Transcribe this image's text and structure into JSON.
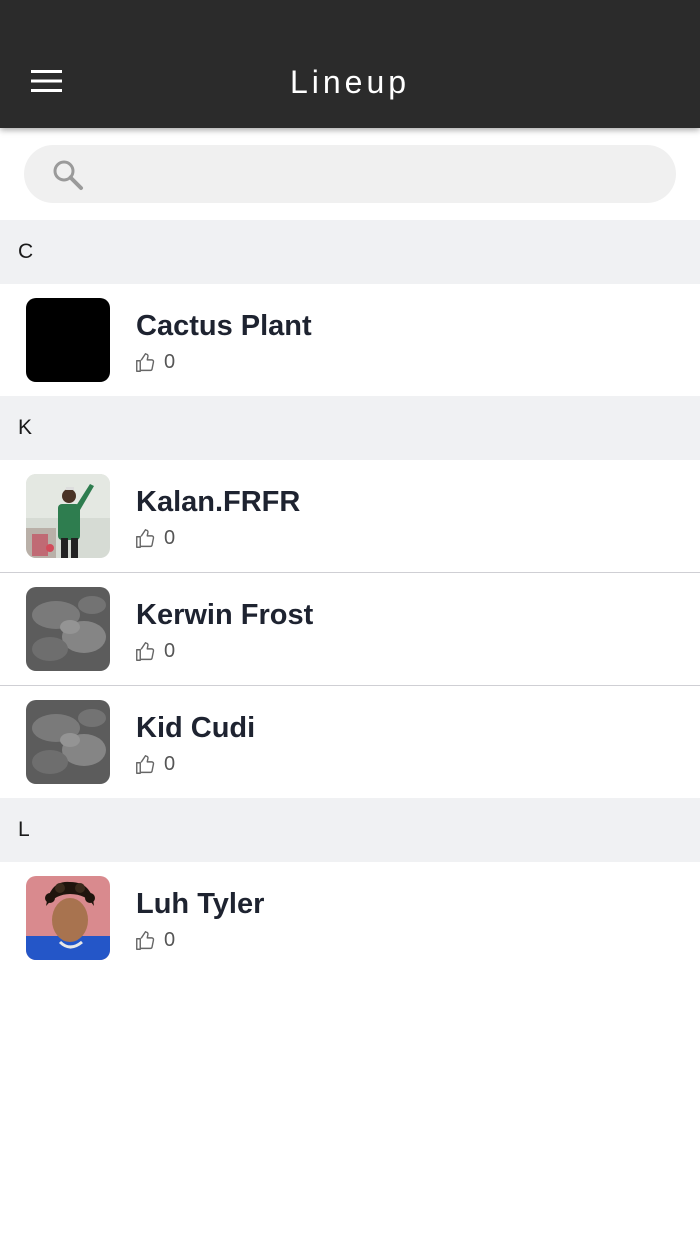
{
  "header": {
    "title": "Lineup",
    "menu_icon": "hamburger-menu-icon"
  },
  "search": {
    "placeholder": "",
    "value": "",
    "icon": "search-icon"
  },
  "sections": [
    {
      "letter": "C",
      "artists": [
        {
          "name": "Cactus Plant",
          "likes": "0",
          "thumbnail": "black-square-image"
        }
      ]
    },
    {
      "letter": "K",
      "artists": [
        {
          "name": "Kalan.FRFR",
          "likes": "0",
          "thumbnail": "artist-photo"
        },
        {
          "name": "Kerwin Frost",
          "likes": "0",
          "thumbnail": "gray-cloud-placeholder"
        },
        {
          "name": "Kid Cudi",
          "likes": "0",
          "thumbnail": "gray-cloud-placeholder"
        }
      ]
    },
    {
      "letter": "L",
      "artists": [
        {
          "name": "Luh Tyler",
          "likes": "0",
          "thumbnail": "artist-photo"
        }
      ]
    }
  ],
  "colors": {
    "topbar": "#2b2b2b",
    "section_bg": "#f0f1f3",
    "name_text": "#1e2330"
  }
}
